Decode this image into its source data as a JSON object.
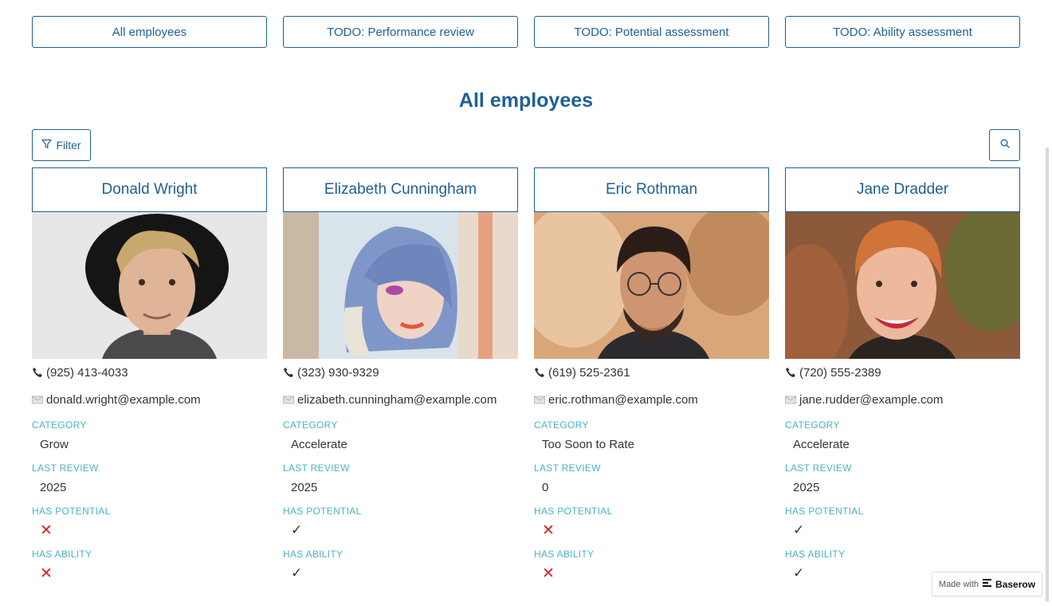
{
  "nav": [
    {
      "label": "All employees"
    },
    {
      "label": "TODO: Performance review"
    },
    {
      "label": "TODO: Potential assessment"
    },
    {
      "label": "TODO: Ability assessment"
    }
  ],
  "page_title": "All employees",
  "toolbar": {
    "filter_label": "Filter",
    "filter_icon": "funnel-icon",
    "search_icon": "search-icon"
  },
  "field_labels": {
    "category": "CATEGORY",
    "last_review": "LAST REVIEW",
    "has_potential": "HAS POTENTIAL",
    "has_ability": "HAS ABILITY"
  },
  "employees": [
    {
      "name": "Donald Wright",
      "phone": "(925) 413-4033",
      "email": "donald.wright@example.com",
      "category": "Grow",
      "last_review": "2025",
      "has_potential": "✕",
      "has_ability": "✕"
    },
    {
      "name": "Elizabeth Cunningham",
      "phone": "(323) 930-9329",
      "email": "elizabeth.cunningham@example.com",
      "category": "Accelerate",
      "last_review": "2025",
      "has_potential": "✓",
      "has_ability": "✓"
    },
    {
      "name": "Eric Rothman",
      "phone": "(619) 525-2361",
      "email": "eric.rothman@example.com",
      "category": "Too Soon to Rate",
      "last_review": "0",
      "has_potential": "✕",
      "has_ability": "✕"
    },
    {
      "name": "Jane Dradder",
      "phone": "(720) 555-2389",
      "email": "jane.rudder@example.com",
      "category": "Accelerate",
      "last_review": "2025",
      "has_potential": "✓",
      "has_ability": "✓"
    }
  ],
  "badge": {
    "prefix": "Made with",
    "brand": "Baserow"
  },
  "colors": {
    "accent": "#1f5f95",
    "label": "#4bb3c3",
    "cross": "#e02020"
  }
}
